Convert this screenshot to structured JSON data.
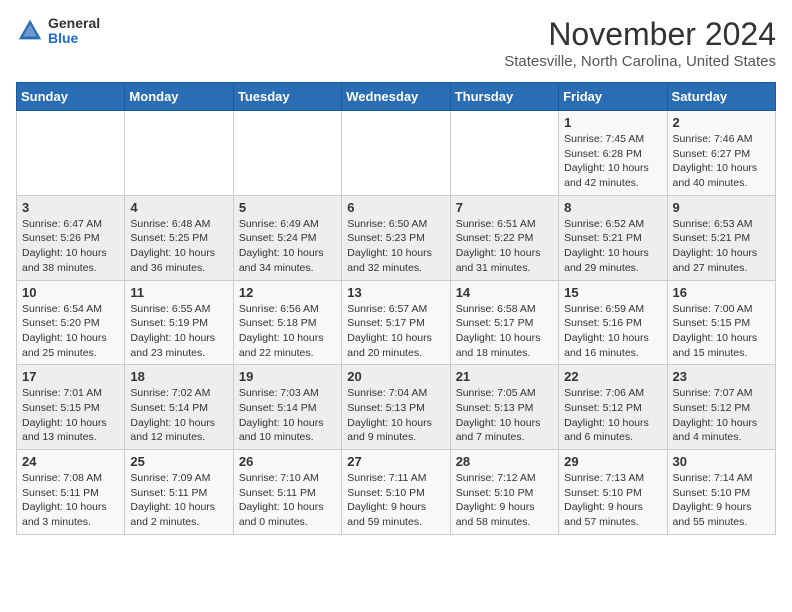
{
  "header": {
    "logo_general": "General",
    "logo_blue": "Blue",
    "title": "November 2024",
    "location": "Statesville, North Carolina, United States"
  },
  "calendar": {
    "weekdays": [
      "Sunday",
      "Monday",
      "Tuesday",
      "Wednesday",
      "Thursday",
      "Friday",
      "Saturday"
    ],
    "weeks": [
      [
        {
          "day": "",
          "info": ""
        },
        {
          "day": "",
          "info": ""
        },
        {
          "day": "",
          "info": ""
        },
        {
          "day": "",
          "info": ""
        },
        {
          "day": "",
          "info": ""
        },
        {
          "day": "1",
          "info": "Sunrise: 7:45 AM\nSunset: 6:28 PM\nDaylight: 10 hours\nand 42 minutes."
        },
        {
          "day": "2",
          "info": "Sunrise: 7:46 AM\nSunset: 6:27 PM\nDaylight: 10 hours\nand 40 minutes."
        }
      ],
      [
        {
          "day": "3",
          "info": "Sunrise: 6:47 AM\nSunset: 5:26 PM\nDaylight: 10 hours\nand 38 minutes."
        },
        {
          "day": "4",
          "info": "Sunrise: 6:48 AM\nSunset: 5:25 PM\nDaylight: 10 hours\nand 36 minutes."
        },
        {
          "day": "5",
          "info": "Sunrise: 6:49 AM\nSunset: 5:24 PM\nDaylight: 10 hours\nand 34 minutes."
        },
        {
          "day": "6",
          "info": "Sunrise: 6:50 AM\nSunset: 5:23 PM\nDaylight: 10 hours\nand 32 minutes."
        },
        {
          "day": "7",
          "info": "Sunrise: 6:51 AM\nSunset: 5:22 PM\nDaylight: 10 hours\nand 31 minutes."
        },
        {
          "day": "8",
          "info": "Sunrise: 6:52 AM\nSunset: 5:21 PM\nDaylight: 10 hours\nand 29 minutes."
        },
        {
          "day": "9",
          "info": "Sunrise: 6:53 AM\nSunset: 5:21 PM\nDaylight: 10 hours\nand 27 minutes."
        }
      ],
      [
        {
          "day": "10",
          "info": "Sunrise: 6:54 AM\nSunset: 5:20 PM\nDaylight: 10 hours\nand 25 minutes."
        },
        {
          "day": "11",
          "info": "Sunrise: 6:55 AM\nSunset: 5:19 PM\nDaylight: 10 hours\nand 23 minutes."
        },
        {
          "day": "12",
          "info": "Sunrise: 6:56 AM\nSunset: 5:18 PM\nDaylight: 10 hours\nand 22 minutes."
        },
        {
          "day": "13",
          "info": "Sunrise: 6:57 AM\nSunset: 5:17 PM\nDaylight: 10 hours\nand 20 minutes."
        },
        {
          "day": "14",
          "info": "Sunrise: 6:58 AM\nSunset: 5:17 PM\nDaylight: 10 hours\nand 18 minutes."
        },
        {
          "day": "15",
          "info": "Sunrise: 6:59 AM\nSunset: 5:16 PM\nDaylight: 10 hours\nand 16 minutes."
        },
        {
          "day": "16",
          "info": "Sunrise: 7:00 AM\nSunset: 5:15 PM\nDaylight: 10 hours\nand 15 minutes."
        }
      ],
      [
        {
          "day": "17",
          "info": "Sunrise: 7:01 AM\nSunset: 5:15 PM\nDaylight: 10 hours\nand 13 minutes."
        },
        {
          "day": "18",
          "info": "Sunrise: 7:02 AM\nSunset: 5:14 PM\nDaylight: 10 hours\nand 12 minutes."
        },
        {
          "day": "19",
          "info": "Sunrise: 7:03 AM\nSunset: 5:14 PM\nDaylight: 10 hours\nand 10 minutes."
        },
        {
          "day": "20",
          "info": "Sunrise: 7:04 AM\nSunset: 5:13 PM\nDaylight: 10 hours\nand 9 minutes."
        },
        {
          "day": "21",
          "info": "Sunrise: 7:05 AM\nSunset: 5:13 PM\nDaylight: 10 hours\nand 7 minutes."
        },
        {
          "day": "22",
          "info": "Sunrise: 7:06 AM\nSunset: 5:12 PM\nDaylight: 10 hours\nand 6 minutes."
        },
        {
          "day": "23",
          "info": "Sunrise: 7:07 AM\nSunset: 5:12 PM\nDaylight: 10 hours\nand 4 minutes."
        }
      ],
      [
        {
          "day": "24",
          "info": "Sunrise: 7:08 AM\nSunset: 5:11 PM\nDaylight: 10 hours\nand 3 minutes."
        },
        {
          "day": "25",
          "info": "Sunrise: 7:09 AM\nSunset: 5:11 PM\nDaylight: 10 hours\nand 2 minutes."
        },
        {
          "day": "26",
          "info": "Sunrise: 7:10 AM\nSunset: 5:11 PM\nDaylight: 10 hours\nand 0 minutes."
        },
        {
          "day": "27",
          "info": "Sunrise: 7:11 AM\nSunset: 5:10 PM\nDaylight: 9 hours\nand 59 minutes."
        },
        {
          "day": "28",
          "info": "Sunrise: 7:12 AM\nSunset: 5:10 PM\nDaylight: 9 hours\nand 58 minutes."
        },
        {
          "day": "29",
          "info": "Sunrise: 7:13 AM\nSunset: 5:10 PM\nDaylight: 9 hours\nand 57 minutes."
        },
        {
          "day": "30",
          "info": "Sunrise: 7:14 AM\nSunset: 5:10 PM\nDaylight: 9 hours\nand 55 minutes."
        }
      ]
    ]
  }
}
